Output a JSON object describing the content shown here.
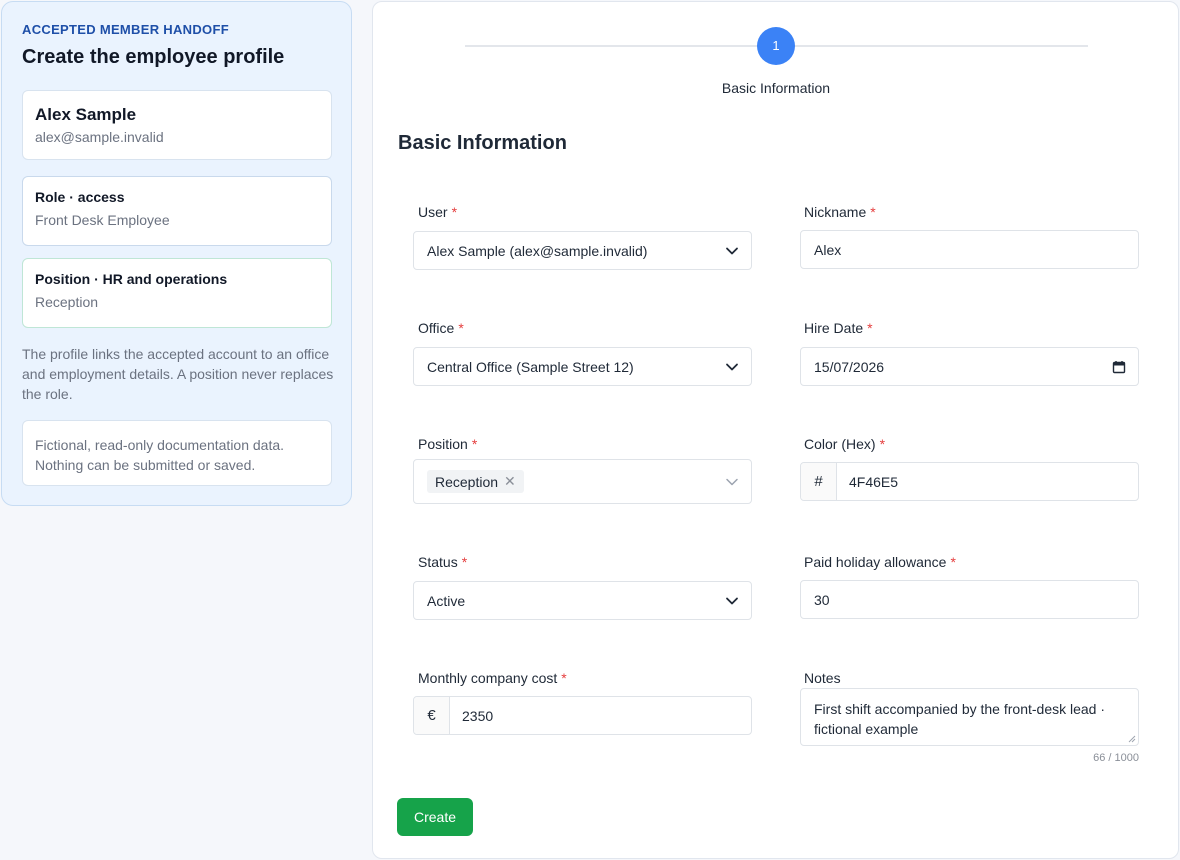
{
  "sidebar": {
    "eyebrow": "ACCEPTED MEMBER HANDOFF",
    "title": "Create the employee profile",
    "user": {
      "name": "Alex Sample",
      "email": "alex@sample.invalid"
    },
    "role": {
      "title": "Role · access",
      "value": "Front Desk Employee"
    },
    "position": {
      "title": "Position · HR and operations",
      "value": "Reception"
    },
    "explanation": "The profile links the accepted account to an office and employment details. A position never replaces the role.",
    "note": "Fictional, read-only documentation data. Nothing can be submitted or saved."
  },
  "stepper": {
    "step_number": "1",
    "step_label": "Basic Information"
  },
  "form": {
    "section_title": "Basic Information",
    "required_mark": "*",
    "user": {
      "label": "User",
      "value": "Alex Sample (alex@sample.invalid)"
    },
    "nickname": {
      "label": "Nickname",
      "value": "Alex"
    },
    "office": {
      "label": "Office",
      "value": "Central Office (Sample Street 12)"
    },
    "hire_date": {
      "label": "Hire Date",
      "value": "15/07/2026"
    },
    "position": {
      "label": "Position",
      "tag": "Reception",
      "tag_remove": "✕"
    },
    "color": {
      "label": "Color (Hex)",
      "prefix": "#",
      "value": "4F46E5"
    },
    "status": {
      "label": "Status",
      "value": "Active"
    },
    "holiday": {
      "label": "Paid holiday allowance",
      "value": "30"
    },
    "cost": {
      "label": "Monthly company cost",
      "prefix": "€",
      "value": "2350"
    },
    "notes": {
      "label": "Notes",
      "value": "First shift accompanied by the front-desk lead · fictional example",
      "counter": "66 / 1000"
    },
    "create_label": "Create"
  },
  "colors": {
    "accent": "#3b82f6",
    "success": "#16a34a",
    "required": "#e53e3e",
    "panel_bg": "#eaf3fe",
    "eyebrow": "#1e4fa8"
  },
  "icons": {
    "select": "chevron-down-icon",
    "calendar": "calendar-icon",
    "tag_remove": "close-icon"
  }
}
